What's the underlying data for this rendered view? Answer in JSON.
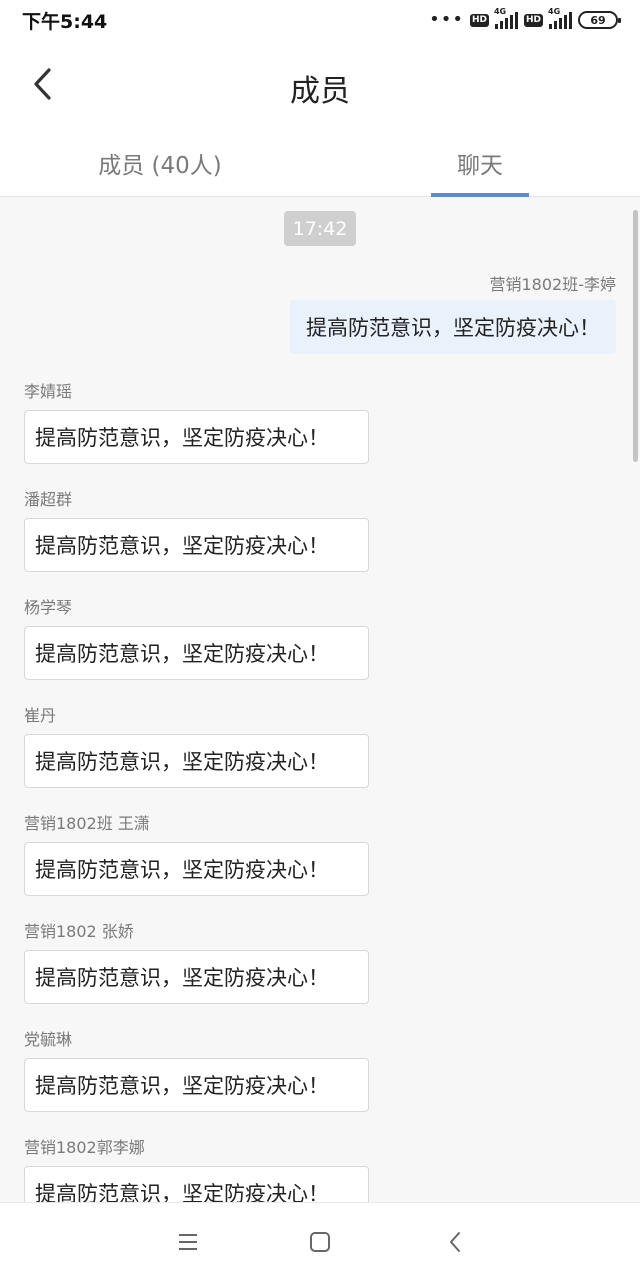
{
  "status_bar": {
    "time": "下午5:44",
    "dots": "•••",
    "hd_label": "HD",
    "network_label": "4G",
    "battery": "69"
  },
  "header": {
    "title": "成员"
  },
  "tabs": [
    {
      "label": "成员 (40人)",
      "active": false
    },
    {
      "label": "聊天",
      "active": true
    }
  ],
  "chat": {
    "time_divider": "17:42",
    "own_message": {
      "sender": "营销1802班-李婷",
      "text": "提高防范意识，坚定防疫决心！"
    },
    "messages": [
      {
        "sender": "李婧瑶",
        "text": "提高防范意识，坚定防疫决心！"
      },
      {
        "sender": "潘超群",
        "text": "提高防范意识，坚定防疫决心！"
      },
      {
        "sender": "杨学琴",
        "text": "提高防范意识，坚定防疫决心！"
      },
      {
        "sender": "崔丹",
        "text": "提高防范意识，坚定防疫决心！"
      },
      {
        "sender": "营销1802班 王潇",
        "text": "提高防范意识，坚定防疫决心！"
      },
      {
        "sender": "营销1802 张娇",
        "text": "提高防范意识，坚定防疫决心！"
      },
      {
        "sender": "党毓琳",
        "text": "提高防范意识，坚定防疫决心！"
      },
      {
        "sender": "营销1802郭李娜",
        "text": "提高防范意识，坚定防疫决心！"
      }
    ]
  },
  "colors": {
    "tab_indicator": "#5b8ad6",
    "own_bubble": "#e9f1fb",
    "time_pill": "#cfcfcf"
  }
}
